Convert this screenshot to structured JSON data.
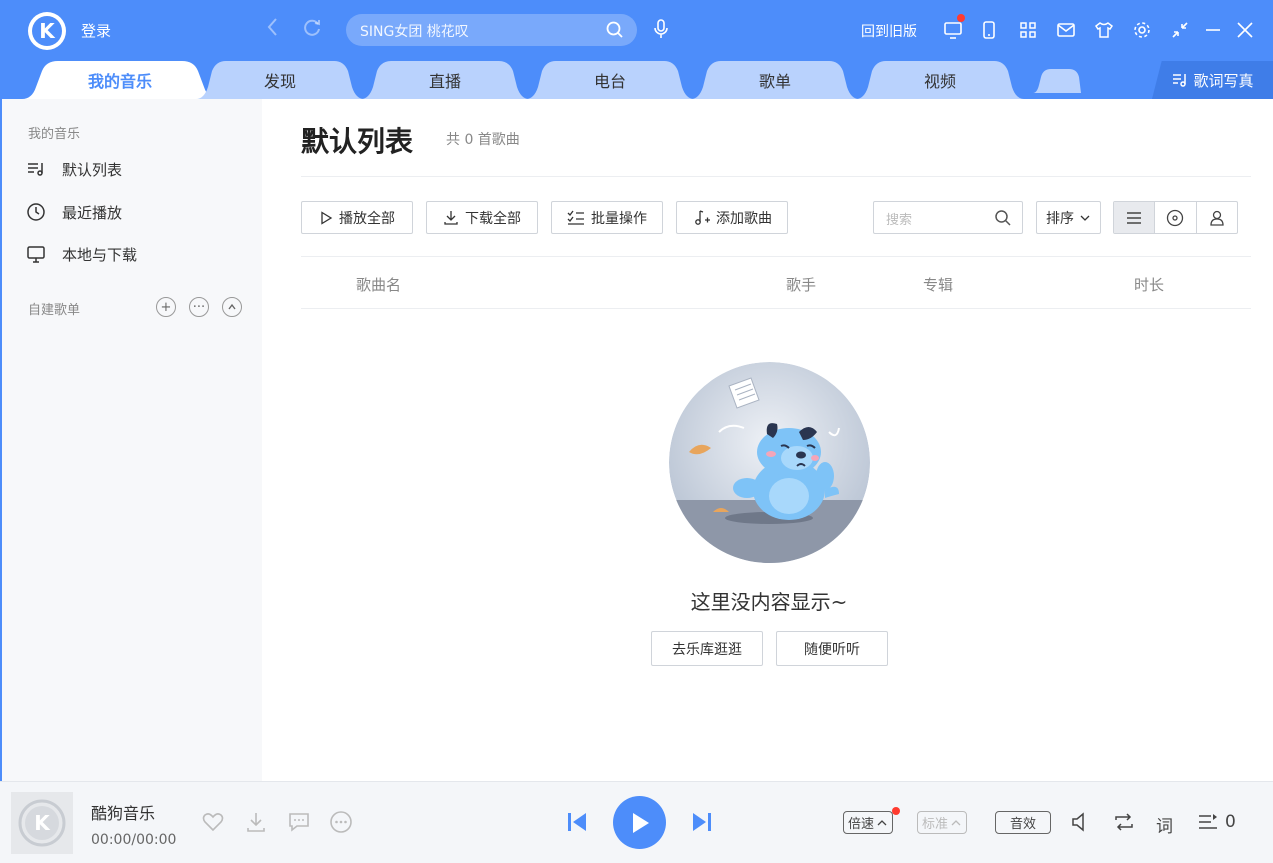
{
  "header": {
    "logo_letter": "K",
    "login": "登录",
    "search_placeholder": "SING女团 桃花叹",
    "old_version": "回到旧版"
  },
  "tabs": [
    {
      "label": "我的音乐",
      "active": true
    },
    {
      "label": "发现",
      "active": false
    },
    {
      "label": "直播",
      "active": false
    },
    {
      "label": "电台",
      "active": false
    },
    {
      "label": "歌单",
      "active": false
    },
    {
      "label": "视频",
      "active": false
    }
  ],
  "lyric_button": "歌词写真",
  "sidebar": {
    "heading": "我的音乐",
    "items": [
      {
        "label": "默认列表",
        "icon": "playlist-icon"
      },
      {
        "label": "最近播放",
        "icon": "clock-icon"
      },
      {
        "label": "本地与下载",
        "icon": "monitor-icon"
      }
    ],
    "custom_heading": "自建歌单"
  },
  "main": {
    "title": "默认列表",
    "count": "共 0 首歌曲",
    "actions": {
      "play_all": "播放全部",
      "download_all": "下载全部",
      "batch": "批量操作",
      "add_song": "添加歌曲"
    },
    "search_placeholder": "搜索",
    "sort": "排序",
    "columns": {
      "name": "歌曲名",
      "artist": "歌手",
      "album": "专辑",
      "duration": "时长"
    },
    "empty_text": "这里没内容显示~",
    "empty_buttons": {
      "browse": "去乐库逛逛",
      "random": "随便听听"
    }
  },
  "player": {
    "song": "酷狗音乐",
    "time": "00:00/00:00",
    "speed": "倍速",
    "quality": "标准",
    "effect": "音效",
    "lyric": "词",
    "queue_count": "0"
  },
  "colors": {
    "accent": "#4d8dfa",
    "tab_inactive": "#b9d2fd"
  }
}
